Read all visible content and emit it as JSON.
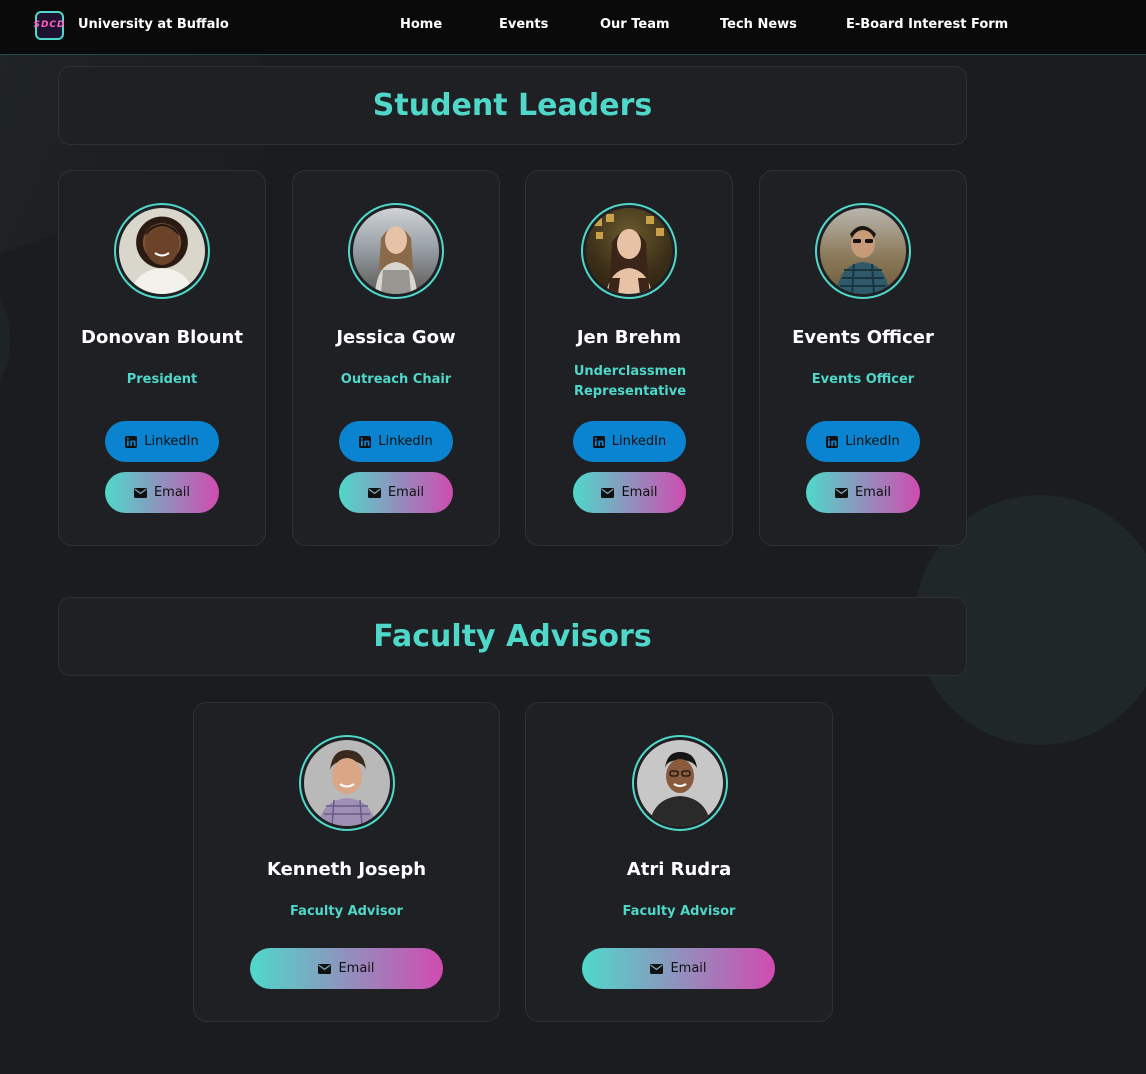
{
  "navbar": {
    "logo_text": "SDCD",
    "brand": "University at Buffalo",
    "links": [
      "Home",
      "Events",
      "Our Team",
      "Tech News",
      "E-Board Interest Form"
    ]
  },
  "student_section": {
    "title": "Student Leaders",
    "members": [
      {
        "name": "Donovan Blount",
        "role": "President",
        "linkedin_label": "LinkedIn",
        "email_label": "Email"
      },
      {
        "name": "Jessica Gow",
        "role": "Outreach Chair",
        "linkedin_label": "LinkedIn",
        "email_label": "Email"
      },
      {
        "name": "Jen Brehm",
        "role": "Underclassmen Representative",
        "linkedin_label": "LinkedIn",
        "email_label": "Email"
      },
      {
        "name": "Events Officer",
        "role": "Events Officer",
        "linkedin_label": "LinkedIn",
        "email_label": "Email"
      }
    ]
  },
  "faculty_section": {
    "title": "Faculty Advisors",
    "members": [
      {
        "name": "Kenneth Joseph",
        "role": "Faculty Advisor",
        "email_label": "Email"
      },
      {
        "name": "Atri Rudra",
        "role": "Faculty Advisor",
        "email_label": "Email"
      }
    ]
  },
  "colors": {
    "accent": "#4fd8ca",
    "linkedin": "#0a84d0",
    "email_gradient_start": "#4fd8ca",
    "email_gradient_end": "#d04bb0",
    "background": "#1b1c1f",
    "card": "#1f2023"
  },
  "icons": {
    "linkedin": "linkedin-icon",
    "email": "envelope-icon"
  }
}
